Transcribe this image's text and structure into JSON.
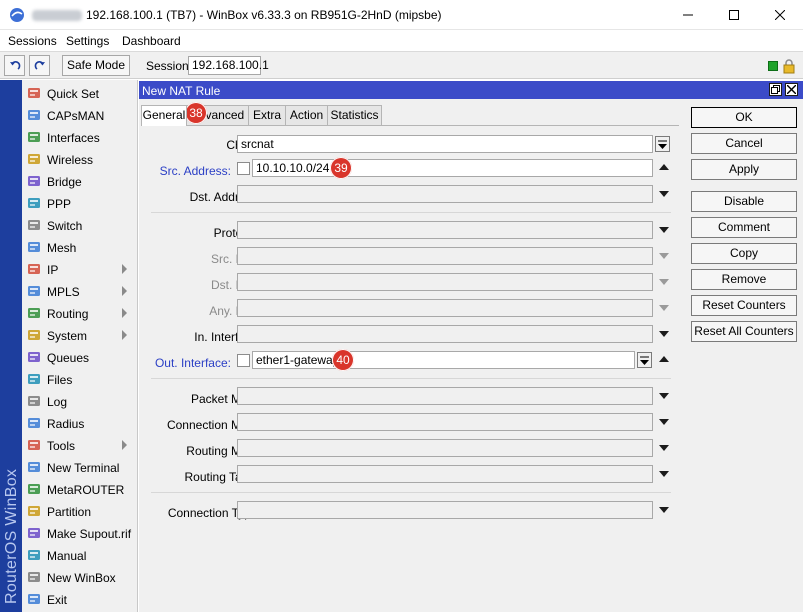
{
  "window": {
    "title": "192.168.100.1 (TB7) - WinBox v6.33.3 on RB951G-2HnD (mipsbe)"
  },
  "menu": [
    "Sessions",
    "Settings",
    "Dashboard"
  ],
  "toolbar": {
    "safe_mode": "Safe Mode",
    "session_label": "Session:",
    "session_value": "192.168.100.1"
  },
  "brand": "RouterOS WinBox",
  "sidebar": {
    "items": [
      {
        "label": "Quick Set",
        "icon": "quick-set-icon",
        "submenu": false
      },
      {
        "label": "CAPsMAN",
        "icon": "capsman-icon",
        "submenu": false
      },
      {
        "label": "Interfaces",
        "icon": "interfaces-icon",
        "submenu": false
      },
      {
        "label": "Wireless",
        "icon": "wireless-icon",
        "submenu": false
      },
      {
        "label": "Bridge",
        "icon": "bridge-icon",
        "submenu": false
      },
      {
        "label": "PPP",
        "icon": "ppp-icon",
        "submenu": false
      },
      {
        "label": "Switch",
        "icon": "switch-icon",
        "submenu": false
      },
      {
        "label": "Mesh",
        "icon": "mesh-icon",
        "submenu": false
      },
      {
        "label": "IP",
        "icon": "ip-icon",
        "submenu": true
      },
      {
        "label": "MPLS",
        "icon": "mpls-icon",
        "submenu": true
      },
      {
        "label": "Routing",
        "icon": "routing-icon",
        "submenu": true
      },
      {
        "label": "System",
        "icon": "system-icon",
        "submenu": true
      },
      {
        "label": "Queues",
        "icon": "queues-icon",
        "submenu": false
      },
      {
        "label": "Files",
        "icon": "files-icon",
        "submenu": false
      },
      {
        "label": "Log",
        "icon": "log-icon",
        "submenu": false
      },
      {
        "label": "Radius",
        "icon": "radius-icon",
        "submenu": false
      },
      {
        "label": "Tools",
        "icon": "tools-icon",
        "submenu": true
      },
      {
        "label": "New Terminal",
        "icon": "terminal-icon",
        "submenu": false
      },
      {
        "label": "MetaROUTER",
        "icon": "metarouter-icon",
        "submenu": false
      },
      {
        "label": "Partition",
        "icon": "partition-icon",
        "submenu": false
      },
      {
        "label": "Make Supout.rif",
        "icon": "supout-icon",
        "submenu": false
      },
      {
        "label": "Manual",
        "icon": "manual-icon",
        "submenu": false
      },
      {
        "label": "New WinBox",
        "icon": "winbox-icon",
        "submenu": false
      },
      {
        "label": "Exit",
        "icon": "exit-icon",
        "submenu": false
      }
    ]
  },
  "dialog": {
    "title": "New NAT Rule",
    "tabs": [
      "General",
      "Advanced",
      "Extra",
      "Action",
      "Statistics"
    ],
    "fields": {
      "chain": {
        "label": "Chain:",
        "value": "srcnat"
      },
      "src_address": {
        "label": "Src. Address:",
        "value": "10.10.10.0/24"
      },
      "dst_address": {
        "label": "Dst. Address:",
        "value": ""
      },
      "protocol": {
        "label": "Protocol:",
        "value": ""
      },
      "src_port": {
        "label": "Src. Port:",
        "value": ""
      },
      "dst_port": {
        "label": "Dst. Port:",
        "value": ""
      },
      "any_port": {
        "label": "Any. Port:",
        "value": ""
      },
      "in_interface": {
        "label": "In. Interface:",
        "value": ""
      },
      "out_interface": {
        "label": "Out. Interface:",
        "value": "ether1-gateway"
      },
      "packet_mark": {
        "label": "Packet Mark:",
        "value": ""
      },
      "connection_mark": {
        "label": "Connection Mark:",
        "value": ""
      },
      "routing_mark": {
        "label": "Routing Mark:",
        "value": ""
      },
      "routing_table": {
        "label": "Routing Table:",
        "value": ""
      },
      "connection_type": {
        "label": "Connection Type:",
        "value": ""
      }
    },
    "buttons": [
      "OK",
      "Cancel",
      "Apply",
      "Disable",
      "Comment",
      "Copy",
      "Remove",
      "Reset Counters",
      "Reset All Counters"
    ]
  },
  "annotations": [
    "38",
    "39",
    "40"
  ],
  "colors": {
    "title_bar_dialog": "#3b4bc8",
    "brand_strip": "#1d3e9e",
    "highlight_label": "#2b3fc5",
    "badge": "#d9352b",
    "status_green": "#1fa32b"
  }
}
